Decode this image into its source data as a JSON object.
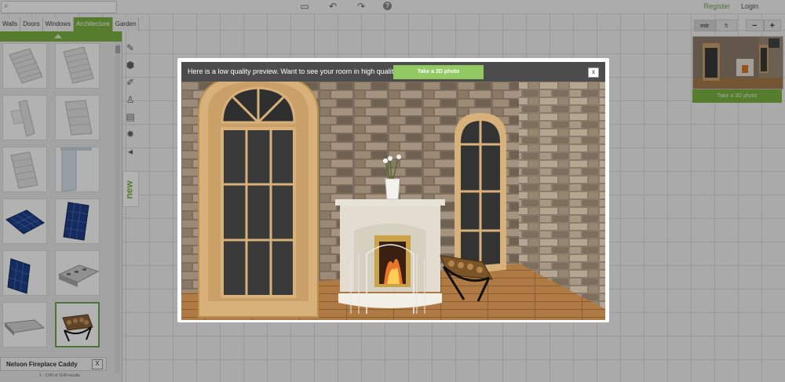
{
  "topbar": {
    "search_icon": "search-icon",
    "toolbar_icons": [
      "file-icon",
      "undo-icon",
      "redo-icon",
      "help-icon"
    ],
    "help_glyph": "?",
    "register": "Register",
    "login": "Login"
  },
  "catalog": {
    "tabs": [
      {
        "label": "Walls",
        "active": false
      },
      {
        "label": "Doors",
        "active": false
      },
      {
        "label": "Windows",
        "active": false
      },
      {
        "label": "Architecture",
        "active": true
      },
      {
        "label": "Garden",
        "active": false
      }
    ],
    "items": [
      "stairs-straight",
      "stairs-straight-2",
      "stairs-spiral",
      "stairs-landing",
      "stairs-flight",
      "glass-railing",
      "solar-panel-flat",
      "solar-panel-upright",
      "solar-panel-large",
      "range-hood",
      "range-hood-steel",
      "fireplace-caddy"
    ],
    "selected_item_index": 11,
    "selected_name": "Nelson Fireplace Caddy",
    "close_glyph": "X",
    "result_count": "1 - 1140 of 1140 results"
  },
  "side_tools": [
    "brush-icon",
    "stone-icon",
    "paint-icon",
    "person-icon",
    "clipboard-icon",
    "settings-icon",
    "collapse-icon"
  ],
  "new_label": "new",
  "view_controls": {
    "units": [
      {
        "label": "mtr",
        "active": true
      },
      {
        "label": "ft",
        "active": false
      }
    ],
    "zoom_out": "−",
    "zoom_in": "+",
    "take_photo": "Take a 3D photo"
  },
  "preview_modal": {
    "message": "Here is a low quality preview. Want to see your room in high quality?",
    "button": "Take a 3D photo",
    "close": "x"
  },
  "colors": {
    "accent": "#7cb342",
    "modal_header": "#4c4c4c"
  }
}
